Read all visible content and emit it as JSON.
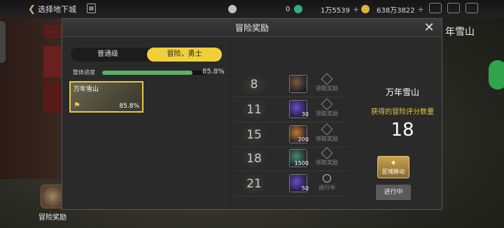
{
  "topbar": {
    "back_label": "选择地下城",
    "calendar_icon": "calendar-icon",
    "currency_1": {
      "icon": "coin-icon",
      "value": "0",
      "color": "#c0c0c0"
    },
    "currency_2": {
      "icon": "gem-icon",
      "value": "1万5539",
      "color": "#2fb07a"
    },
    "currency_3": {
      "icon": "gold-icon",
      "value": "638万3822",
      "color": "#e0b040"
    },
    "icons": [
      "crown-icon",
      "mail-icon",
      "menu-icon"
    ]
  },
  "background": {
    "right_title": "年雪山",
    "bottom_button_label": "冒险奖励"
  },
  "modal": {
    "title": "冒险奖励",
    "tabs": {
      "normal": "普通级",
      "adventure": "冒险，勇士"
    },
    "progress": {
      "label": "整体进度",
      "value": 0.858,
      "text": "85.8%"
    },
    "region_card": {
      "name": "万年雪山",
      "percent": "85.8%"
    },
    "rewards": [
      {
        "score": "8",
        "item_icon": "chest-icon",
        "qty": "",
        "claim": "领取奖励",
        "state": "locked",
        "item_color": "#7a5a3a"
      },
      {
        "score": "11",
        "item_icon": "orb-icon",
        "qty": "30",
        "claim": "领取奖励",
        "state": "locked",
        "item_color": "#6a4ad0"
      },
      {
        "score": "15",
        "item_icon": "crystal-icon",
        "qty": "200",
        "claim": "领取奖励",
        "state": "locked",
        "item_color": "#c07a30"
      },
      {
        "score": "18",
        "item_icon": "gem-icon",
        "qty": "1500",
        "claim": "领取奖励",
        "state": "locked",
        "item_color": "#4a8a6a"
      },
      {
        "score": "21",
        "item_icon": "orb-icon",
        "qty": "50",
        "claim": "进行中",
        "state": "in-progress",
        "item_color": "#6a4ad0"
      }
    ],
    "info": {
      "region_name": "万年雪山",
      "subtitle": "获得的冒险评分数量",
      "score": "18",
      "move_button": "区域移动",
      "status": "进行中"
    }
  }
}
